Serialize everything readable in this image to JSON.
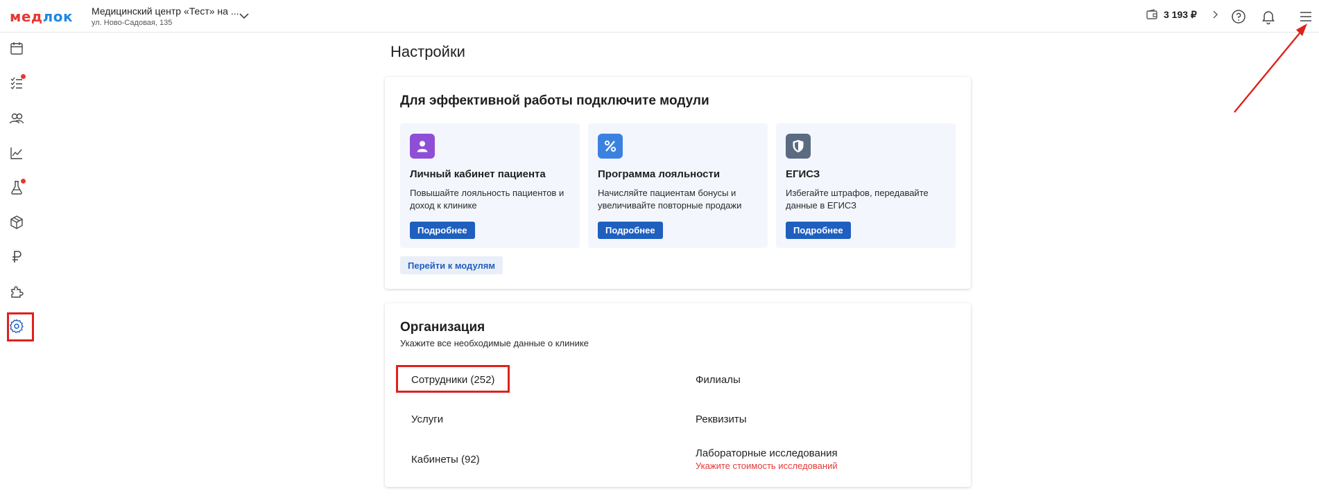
{
  "header": {
    "logo_part1": "мед",
    "logo_part2": "лок",
    "clinic_name": "Медицинский центр «Тест» на ...",
    "clinic_address": "ул. Ново-Садовая, 135",
    "balance": "3 193 ₽",
    "icons": [
      "wallet-icon",
      "chevron-right-icon",
      "help-icon",
      "bell-icon",
      "menu-icon"
    ]
  },
  "sidebar": {
    "items": [
      {
        "name": "calendar-icon",
        "badge": false
      },
      {
        "name": "tasks-icon",
        "badge": true
      },
      {
        "name": "patients-icon",
        "badge": false
      },
      {
        "name": "analytics-icon",
        "badge": false
      },
      {
        "name": "lab-icon",
        "badge": true
      },
      {
        "name": "warehouse-icon",
        "badge": false
      },
      {
        "name": "finance-icon",
        "badge": false
      },
      {
        "name": "modules-icon",
        "badge": false
      },
      {
        "name": "settings-icon",
        "badge": false,
        "active": true
      }
    ]
  },
  "page": {
    "title": "Настройки"
  },
  "modules_card": {
    "title": "Для эффективной работы подключите модули",
    "modules": [
      {
        "title": "Личный кабинет пациента",
        "desc": "Повышайте лояльность пациентов и доход к клинике",
        "button": "Подробнее",
        "icon": "patient-icon",
        "color": "#8e4fd6"
      },
      {
        "title": "Программа лояльности",
        "desc": "Начисляйте пациентам бонусы и увеличивайте повторные продажи",
        "button": "Подробнее",
        "icon": "percent-icon",
        "color": "#3b82e0"
      },
      {
        "title": "ЕГИСЗ",
        "desc": "Избегайте штрафов, передавайте данные в ЕГИСЗ",
        "button": "Подробнее",
        "icon": "shield-icon",
        "color": "#5a6b82"
      }
    ],
    "goto_button": "Перейти к модулям"
  },
  "org_card": {
    "title": "Организация",
    "subtitle": "Укажите все необходимые данные о клинике",
    "links": {
      "employees": "Сотрудники (252)",
      "branches": "Филиалы",
      "services": "Услуги",
      "requisites": "Реквизиты",
      "cabinets": "Кабинеты (92)",
      "lab": "Лабораторные исследования",
      "lab_note": "Укажите стоимость исследований"
    }
  },
  "colors": {
    "accent": "#1e5fbf",
    "highlight": "#e0201b",
    "badge": "#e53935"
  }
}
